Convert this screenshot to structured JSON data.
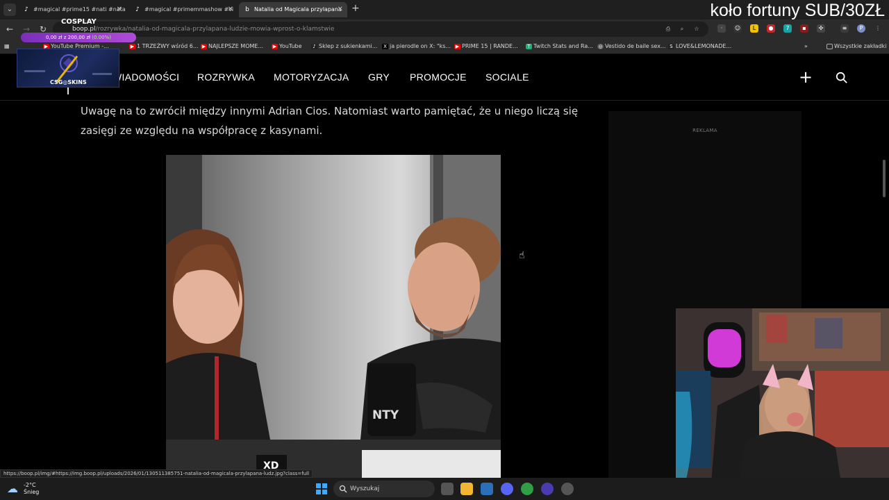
{
  "browser": {
    "tabs": [
      {
        "title": "#magical #prime15 #nati #nata",
        "favicon": "tiktok-icon"
      },
      {
        "title": "#magical #primemmashow #vi",
        "favicon": "tiktok-icon"
      },
      {
        "title": "Natalia od Magicala przylapana",
        "favicon": "boop-icon",
        "active": true
      }
    ],
    "url_domain": "boop.pl",
    "url_path": "/rozrywka/natalia-od-magicala-przylapana-ludzie-mowia-wprost-o-klamstwie",
    "bookmarks": [
      "YouTube Premium -...",
      "1 TRZEŹWY wśród 6...",
      "NAJLEPSZE MOME...",
      "YouTube",
      "Sklep z sukienkami...",
      "ja pierodle on X: \"ks...",
      "PRIME 15 | RANDE...",
      "Twitch Stats and Ra...",
      "Vestido de baile sex...",
      "LOVE&LEMONADE..."
    ],
    "all_bookmarks": "Wszystkie zakładki",
    "status_url": "https://boop.pl/img/#https://img.boop.pl/uploads/2026/01/130511385751-natalia-od-magicala-przylapana-ludz.jpg?class=full"
  },
  "stream_overlay": {
    "wheel_text": "koło fortuny SUB/30ZŁ",
    "goal_title": "COSPLAY",
    "goal_amount": "0,00 zł z 200,00 zł",
    "goal_percent": "(0.00%)",
    "sponsor": "CSG◎SKINS"
  },
  "site": {
    "nav": [
      "WIADOMOŚCI",
      "ROZRYWKA",
      "MOTORYZACJA",
      "GRY",
      "PROMOCJE",
      "SOCIALE"
    ],
    "article_paragraph": "Uwagę na to zwrócił między innymi Adrian Cios. Natomiast warto pamiętać, że u niego liczą się zasięgi ze względu na współpracę z kasynami.",
    "ad_label": "REKLAMA",
    "photo_caption_badge": "XD"
  },
  "taskbar": {
    "weather_temp": "-2°C",
    "weather_desc": "Śnieg",
    "search_placeholder": "Wyszukaj"
  },
  "colors": {
    "page_bg": "#000000",
    "nav_text": "#ffffff",
    "article_text": "#d8d8d8",
    "goal_bar": "#9b3fd0",
    "goal_percent": "#9dff6a"
  }
}
